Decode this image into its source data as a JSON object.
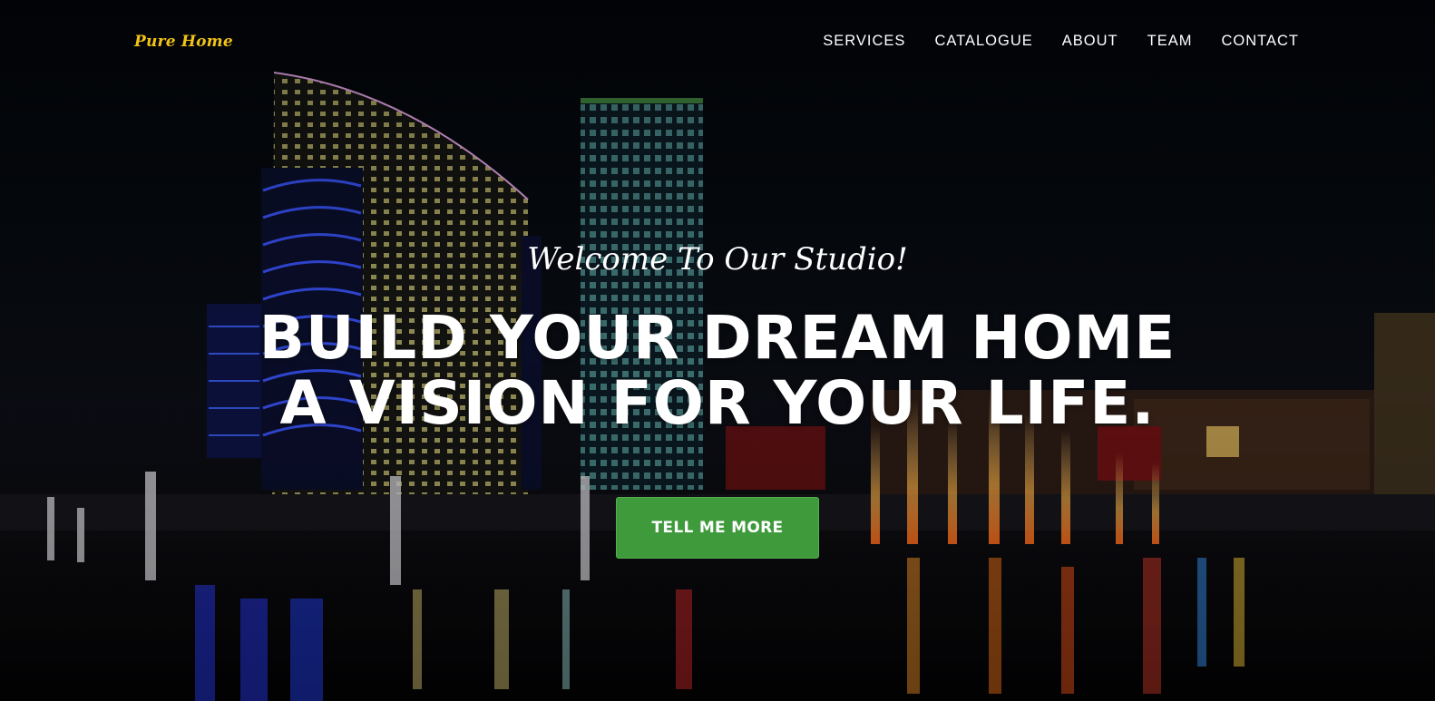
{
  "brand": {
    "name": "Pure Home",
    "color": "#f2c317"
  },
  "nav": {
    "items": [
      {
        "label": "SERVICES"
      },
      {
        "label": "CATALOGUE"
      },
      {
        "label": "ABOUT"
      },
      {
        "label": "TEAM"
      },
      {
        "label": "CONTACT"
      }
    ]
  },
  "hero": {
    "subheading": "Welcome To Our Studio!",
    "heading_line1": "BUILD YOUR DREAM HOME",
    "heading_line2": "A VISION FOR YOUR LIFE.",
    "cta_label": "TELL ME MORE",
    "cta_color": "#3f9a3c",
    "background_image": "night city skyline with waterfront fountains"
  }
}
